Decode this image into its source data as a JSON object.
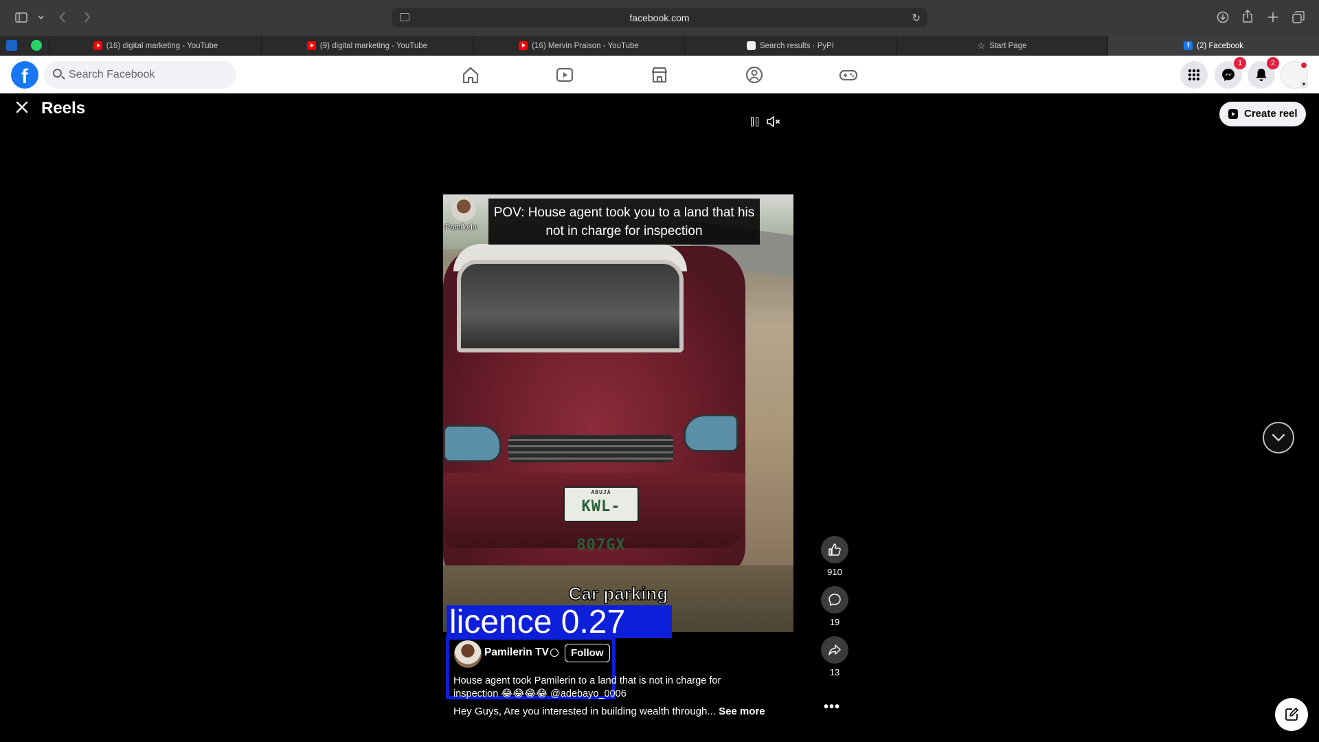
{
  "browser": {
    "url": "facebook.com",
    "tabs": [
      {
        "label": "(16) digital marketing - YouTube",
        "favicon": "youtube-icon"
      },
      {
        "label": "(9) digital marketing - YouTube",
        "favicon": "youtube-icon"
      },
      {
        "label": "(16) Mervin Praison - YouTube",
        "favicon": "youtube-icon"
      },
      {
        "label": "Search results · PyPI",
        "favicon": "pypi-icon"
      },
      {
        "label": "Start Page",
        "favicon": "star-icon"
      },
      {
        "label": "(2) Facebook",
        "favicon": "facebook-icon",
        "active": true
      }
    ]
  },
  "facebook": {
    "search_placeholder": "Search Facebook",
    "messenger_badge": "1",
    "notifications_badge": "2",
    "brand_color": "#1877f2"
  },
  "reels": {
    "title": "Reels",
    "create_label": "Create reel",
    "overlay_title": "POV: House agent took you to a land that his not in charge for inspection",
    "overlay_channel": "Pamilerin",
    "plate_text": "KWL-807GX",
    "plate_state": "ABUJA",
    "overlay_caption": "Car parking",
    "detection_label": "licence  0.27",
    "detection_color": "#0d1fd8",
    "author": "Pamilerin TV",
    "follow_label": "Follow",
    "caption": "House agent took Pamilerin to a land that is not in charge for inspection 😂😂😂😂 @adebayo_0006",
    "description": "Hey Guys, Are you interested in building wealth through...",
    "see_more": "See more",
    "likes": "910",
    "comments": "19",
    "shares": "13",
    "more": "•••"
  }
}
